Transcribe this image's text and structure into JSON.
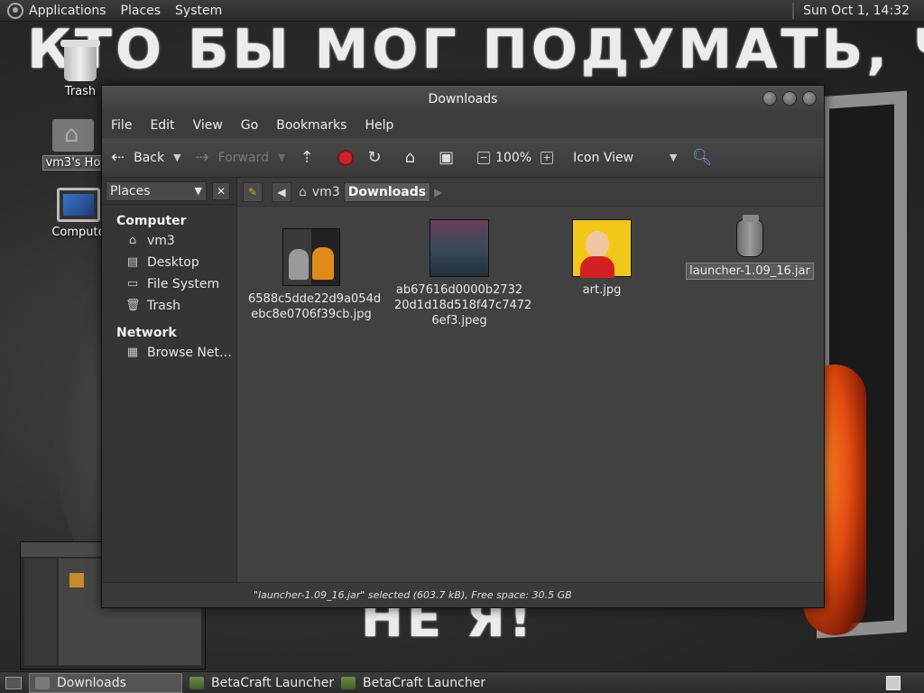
{
  "top_panel": {
    "menus": [
      "Applications",
      "Places",
      "System"
    ],
    "clock": "Sun Oct  1, 14:32"
  },
  "wallpaper": {
    "chalk_top": "КТО БЫ МОГ ПОДУМАТЬ, ЧТО Я -",
    "chalk_bottom": "НЕ Я!"
  },
  "desktop_icons": {
    "trash": "Trash",
    "home": "vm3's Ho",
    "computer": "Compute"
  },
  "window": {
    "title": "Downloads",
    "menus": [
      "File",
      "Edit",
      "View",
      "Go",
      "Bookmarks",
      "Help"
    ],
    "toolbar": {
      "back": "Back",
      "forward": "Forward",
      "zoom": "100%",
      "view_mode": "Icon View"
    },
    "sidebar": {
      "selector": "Places",
      "section_computer": "Computer",
      "computer_items": [
        "vm3",
        "Desktop",
        "File System",
        "Trash"
      ],
      "section_network": "Network",
      "network_items": [
        "Browse Net…"
      ]
    },
    "pathbar": {
      "crumbs": [
        "vm3",
        "Downloads"
      ]
    },
    "files": [
      {
        "name_line1": "6588c5dde22d9a054d",
        "name_line2": "ebc8e0706f39cb.jpg",
        "name_line3": ""
      },
      {
        "name_line1": "ab67616d0000b2732",
        "name_line2": "20d1d18d518f47c7472",
        "name_line3": "6ef3.jpeg"
      },
      {
        "name_line1": "art.jpg",
        "name_line2": "",
        "name_line3": ""
      },
      {
        "name_line1": "launcher-1.09_16.jar",
        "name_line2": "",
        "name_line3": ""
      }
    ],
    "statusbar": "\"launcher-1.09_16.jar\" selected (603.7 kB), Free space: 30.5 GB"
  },
  "taskbar": {
    "tasks": [
      "Downloads",
      "BetaCraft Launcher ...",
      "BetaCraft Launcher ..."
    ]
  }
}
